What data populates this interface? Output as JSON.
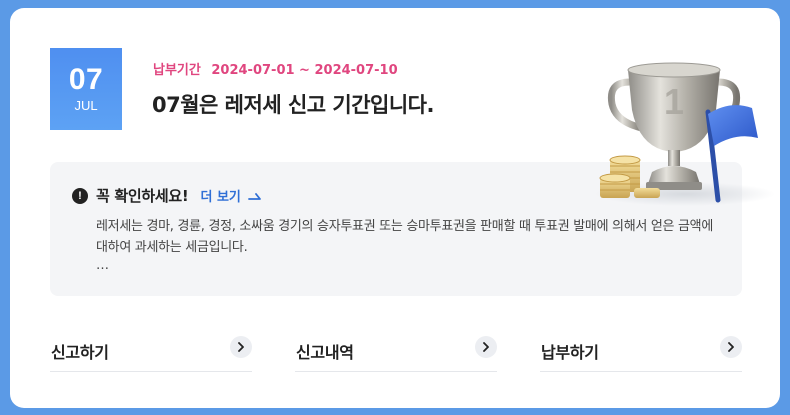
{
  "date_badge": {
    "day": "07",
    "month": "JUL"
  },
  "period": {
    "label": "납부기간",
    "dates": "2024-07-01 ~ 2024-07-10"
  },
  "headline": "07월은 레저세 신고 기간입니다.",
  "notice": {
    "title": "꼭 확인하세요!",
    "more_label": "더 보기",
    "body": "레저세는 경마, 경륜, 경정, 소싸움 경기의 승자투표권 또는 승마투표권을 판매할 때 투표권 발매에 의해서 얻은 금액에 대하여 과세하는 세금입니다.",
    "ellipsis": "…"
  },
  "actions": [
    {
      "label": "신고하기"
    },
    {
      "label": "신고내역"
    },
    {
      "label": "납부하기"
    }
  ],
  "icons": [
    "alert-icon",
    "arrow-right-icon",
    "chevron-right-icon",
    "trophy-illustration",
    "flag-illustration",
    "coins-illustration"
  ],
  "colors": {
    "background": "#5b9ae6",
    "badge": "#4f8ff0",
    "period": "#e0467f",
    "link": "#2f6fd6"
  }
}
